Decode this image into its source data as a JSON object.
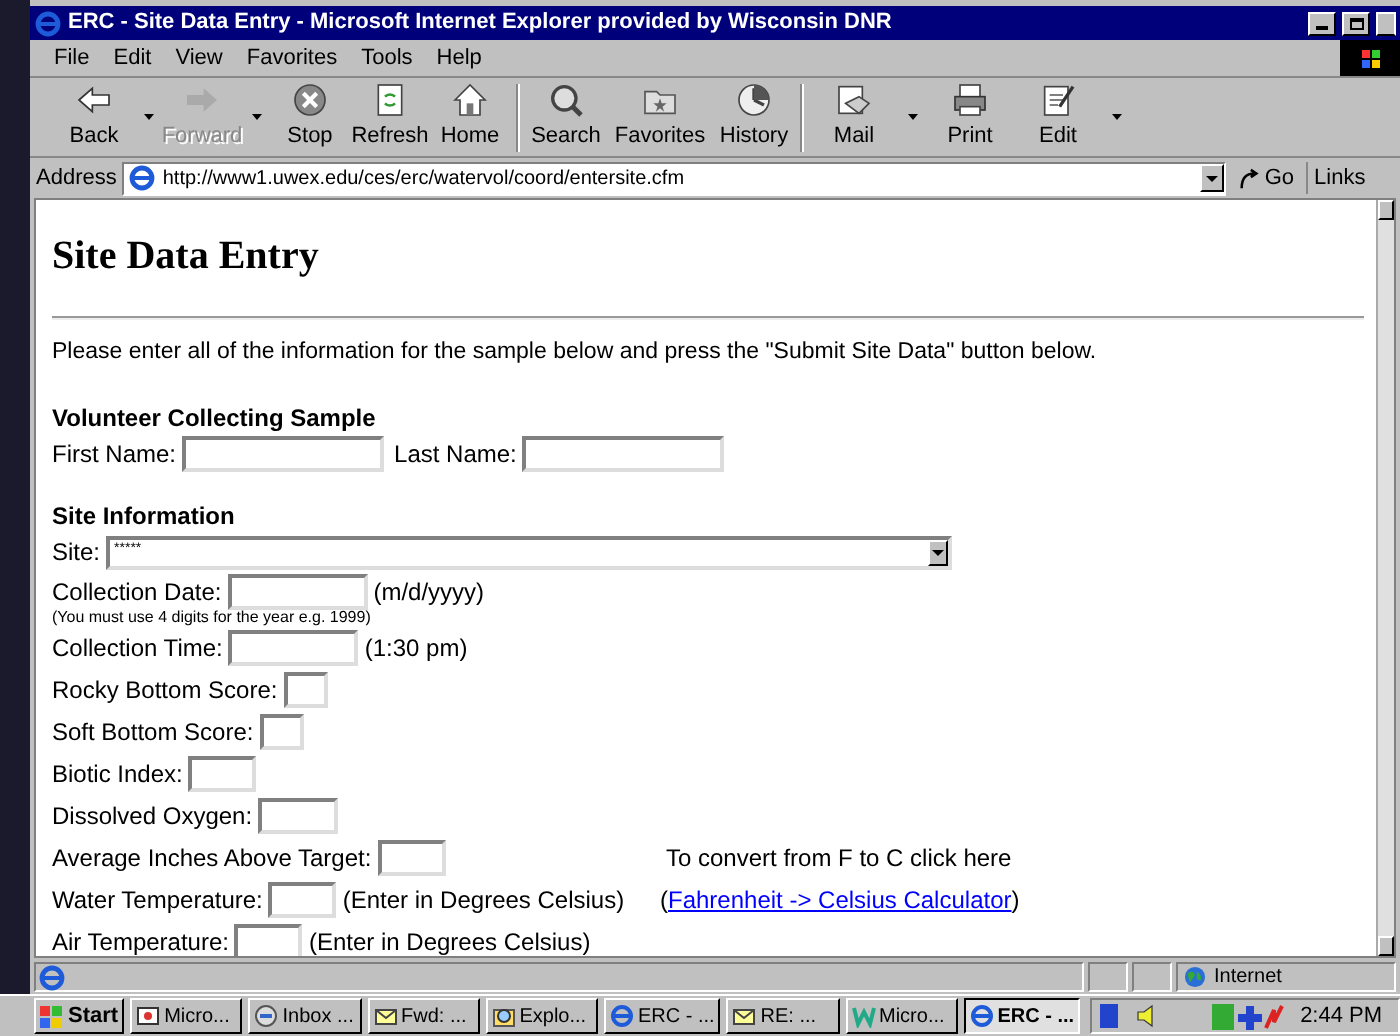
{
  "window": {
    "title": "ERC - Site Data Entry - Microsoft Internet Explorer provided by Wisconsin DNR"
  },
  "menu": [
    "File",
    "Edit",
    "View",
    "Favorites",
    "Tools",
    "Help"
  ],
  "toolbar": [
    {
      "label": "Back",
      "kind": "back",
      "disabled": false,
      "dropdown": true
    },
    {
      "label": "Forward",
      "kind": "forward",
      "disabled": true,
      "dropdown": true
    },
    {
      "label": "Stop",
      "kind": "stop",
      "disabled": false,
      "dropdown": false
    },
    {
      "label": "Refresh",
      "kind": "refresh",
      "disabled": false,
      "dropdown": false
    },
    {
      "label": "Home",
      "kind": "home",
      "disabled": false,
      "dropdown": false
    },
    {
      "label": "Search",
      "kind": "search",
      "disabled": false,
      "dropdown": false
    },
    {
      "label": "Favorites",
      "kind": "favorites",
      "disabled": false,
      "dropdown": false
    },
    {
      "label": "History",
      "kind": "history",
      "disabled": false,
      "dropdown": false
    },
    {
      "label": "Mail",
      "kind": "mail",
      "disabled": false,
      "dropdown": true
    },
    {
      "label": "Print",
      "kind": "print",
      "disabled": false,
      "dropdown": false
    },
    {
      "label": "Edit",
      "kind": "edit",
      "disabled": false,
      "dropdown": true
    }
  ],
  "address": {
    "label": "Address",
    "url": "http://www1.uwex.edu/ces/erc/watervol/coord/entersite.cfm",
    "go": "Go",
    "links": "Links"
  },
  "page": {
    "heading": "Site Data Entry",
    "intro": "Please enter all of the information for the sample below and press the \"Submit Site Data\" button below.",
    "volunteer": {
      "heading": "Volunteer Collecting Sample",
      "first_label": "First Name:",
      "last_label": "Last Name:"
    },
    "site_heading": "Site Information",
    "site": {
      "label": "Site:",
      "value": "*****"
    },
    "rows": [
      {
        "label": "Collection Date:",
        "kind": "date",
        "suffix": "(m/d/yyyy)",
        "note": "(You must use 4 digits for the year e.g. 1999)"
      },
      {
        "label": "Collection Time:",
        "kind": "time",
        "suffix": "(1:30 pm)"
      },
      {
        "label": "Rocky Bottom Score:",
        "kind": "score"
      },
      {
        "label": "Soft Bottom Score:",
        "kind": "score"
      },
      {
        "label": "Biotic Index:",
        "kind": "number"
      },
      {
        "label": "Dissolved Oxygen:",
        "kind": "decimal"
      },
      {
        "label": "Average Inches Above Target:",
        "kind": "number",
        "aside": {
          "kind": "text",
          "text": "To convert from F to C click here"
        }
      },
      {
        "label": "Water Temperature:",
        "kind": "number",
        "suffix": "(Enter in Degrees Celsius)",
        "aside": {
          "kind": "link",
          "prefix": "(",
          "text": "Fahrenheit -> Celsius Calculator",
          "suffix": ")"
        }
      },
      {
        "label": "Air Temperature:",
        "kind": "number",
        "suffix": "(Enter in Degrees Celsius)"
      }
    ]
  },
  "status_bar": {
    "zone": "Internet"
  },
  "taskbar": {
    "start": "Start",
    "items": [
      {
        "label": "Micro...",
        "kind": "app",
        "selected": false
      },
      {
        "label": "Inbox ...",
        "kind": "inbox",
        "selected": false
      },
      {
        "label": "Fwd: ...",
        "kind": "mail",
        "selected": false
      },
      {
        "label": "Explo...",
        "kind": "explorer",
        "selected": false
      },
      {
        "label": "ERC - ...",
        "kind": "ie",
        "selected": false
      },
      {
        "label": "RE: ...",
        "kind": "mail",
        "selected": false
      },
      {
        "label": "Micro...",
        "kind": "word",
        "selected": false
      },
      {
        "label": "ERC - ...",
        "kind": "ie",
        "selected": true
      }
    ],
    "clock": "2:44 PM"
  }
}
